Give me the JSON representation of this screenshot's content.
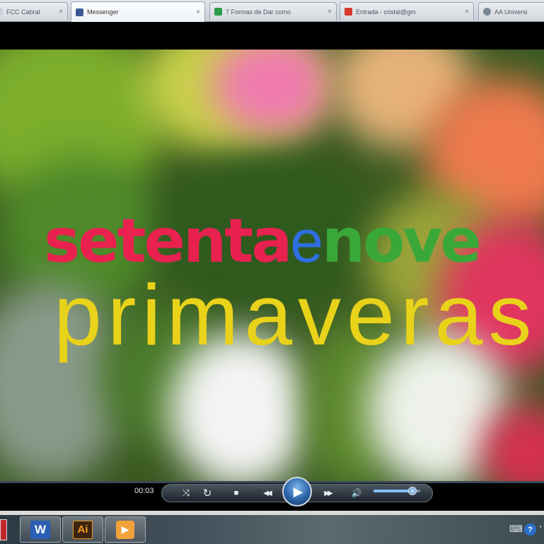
{
  "browser": {
    "tabs": [
      {
        "label": "FCC Cabral",
        "icon": "document-icon",
        "active": false
      },
      {
        "label": "Messenger",
        "icon": "facebook-icon",
        "active": true
      },
      {
        "label": "7 Formas de Dar como",
        "icon": "sheet-icon",
        "active": false
      },
      {
        "label": "Entrada - cristal@gm",
        "icon": "gmail-icon",
        "active": false
      },
      {
        "label": "AA Universi",
        "icon": "person-icon",
        "active": false
      }
    ],
    "tab_close_glyph": "×"
  },
  "video": {
    "title_word_1": "setenta",
    "title_word_2": "e",
    "title_word_3": "nove",
    "title_line_2": "primaveras",
    "colors": {
      "word1": "#e8214f",
      "word2": "#2f6ee0",
      "word3": "#3aa838",
      "line2": "#e9d21a"
    }
  },
  "player": {
    "elapsed_time": "00:03",
    "seek_progress": 0.0,
    "volume_level": 0.84,
    "controls": {
      "shuffle_icon": "⤨",
      "repeat_icon": "↻",
      "stop_icon": "■",
      "prev_icon": "◀◀",
      "play_icon": "▶",
      "next_icon": "▶▶",
      "volume_icon": "🔊"
    }
  },
  "taskbar": {
    "apps": [
      {
        "name": "word",
        "label": "W",
        "color": "#2b5fb4"
      },
      {
        "name": "illustrator",
        "label": "Ai",
        "color": "#f29a1f"
      },
      {
        "name": "media-player",
        "label": "▶",
        "color": "#f3a23a"
      }
    ],
    "tray": {
      "keyboard_icon": "⌨",
      "help_label": "?",
      "extra": "'"
    }
  }
}
